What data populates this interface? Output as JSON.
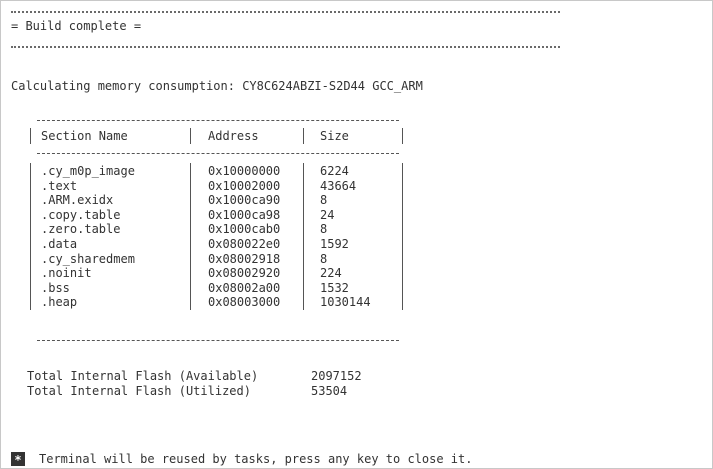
{
  "banner": {
    "title": "= Build complete ="
  },
  "memory_line": "Calculating memory consumption: CY8C624ABZI-S2D44 GCC_ARM",
  "table": {
    "headers": [
      "Section Name",
      "Address",
      "Size"
    ],
    "rows": [
      [
        ".cy_m0p_image",
        "0x10000000",
        "6224"
      ],
      [
        ".text",
        "0x10002000",
        "43664"
      ],
      [
        ".ARM.exidx",
        "0x1000ca90",
        "8"
      ],
      [
        ".copy.table",
        "0x1000ca98",
        "24"
      ],
      [
        ".zero.table",
        "0x1000cab0",
        "8"
      ],
      [
        ".data",
        "0x080022e0",
        "1592"
      ],
      [
        ".cy_sharedmem",
        "0x08002918",
        "8"
      ],
      [
        ".noinit",
        "0x08002920",
        "224"
      ],
      [
        ".bss",
        "0x08002a00",
        "1532"
      ],
      [
        ".heap",
        "0x08003000",
        "1030144"
      ]
    ]
  },
  "totals": [
    {
      "label": "Total Internal Flash (Available)",
      "value": "2097152"
    },
    {
      "label": "Total Internal Flash (Utilized)",
      "value": "53504"
    }
  ],
  "footer": {
    "badge": "*",
    "message": "Terminal will be reused by tasks, press any key to close it."
  }
}
